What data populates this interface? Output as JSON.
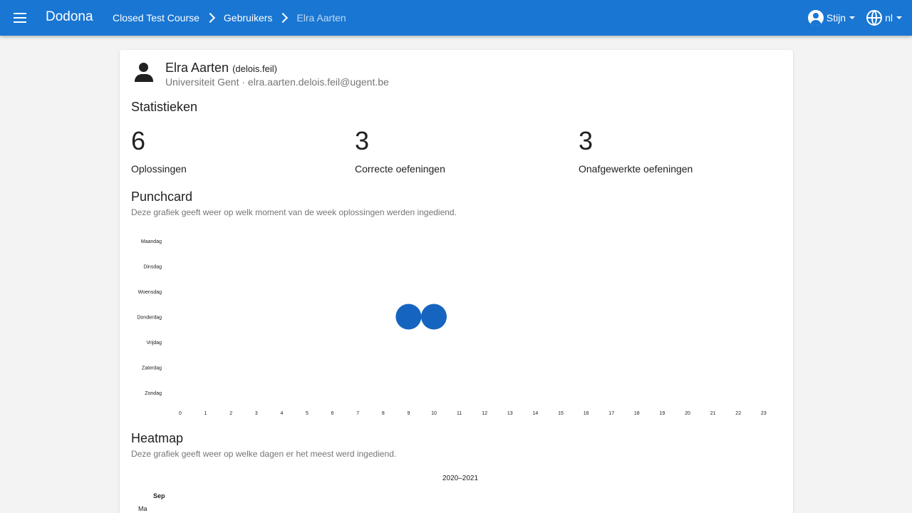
{
  "topbar": {
    "brand": "Dodona",
    "breadcrumbs": [
      "Closed Test Course",
      "Gebruikers",
      "Elra Aarten"
    ],
    "account_label": "Stijn",
    "language_label": "nl",
    "color": "#1976d2"
  },
  "user": {
    "name": "Elra Aarten",
    "username": "(delois.feil)",
    "meta": "Universiteit Gent · elra.aarten.delois.feil@ugent.be"
  },
  "statistics": {
    "title": "Statistieken",
    "items": [
      {
        "value": "6",
        "label": "Oplossingen"
      },
      {
        "value": "3",
        "label": "Correcte oefeningen"
      },
      {
        "value": "3",
        "label": "Onafgewerkte oefeningen"
      }
    ]
  },
  "punchcard": {
    "title": "Punchcard",
    "subtitle": "Deze grafiek geeft weer op welk moment van de week oplossingen werden ingediend."
  },
  "heatmap": {
    "title": "Heatmap",
    "subtitle": "Deze grafiek geeft weer op welke dagen er het meest werd ingediend.",
    "year_label": "2020–2021",
    "month_label": "Sep",
    "day_label": "Ma"
  },
  "chart_data": {
    "type": "scatter",
    "title": "",
    "y_categories": [
      "Maandag",
      "Dinsdag",
      "Woensdag",
      "Donderdag",
      "Vrijdag",
      "Zaterdag",
      "Zondag"
    ],
    "x_categories": [
      "0",
      "1",
      "2",
      "3",
      "4",
      "5",
      "6",
      "7",
      "8",
      "9",
      "10",
      "11",
      "12",
      "13",
      "14",
      "15",
      "16",
      "17",
      "18",
      "19",
      "20",
      "21",
      "22",
      "23"
    ],
    "points": [
      {
        "day": "Donderdag",
        "hour": 9,
        "count": 3
      },
      {
        "day": "Donderdag",
        "hour": 10,
        "count": 3
      }
    ],
    "color": "#1565c0",
    "grid": false
  }
}
